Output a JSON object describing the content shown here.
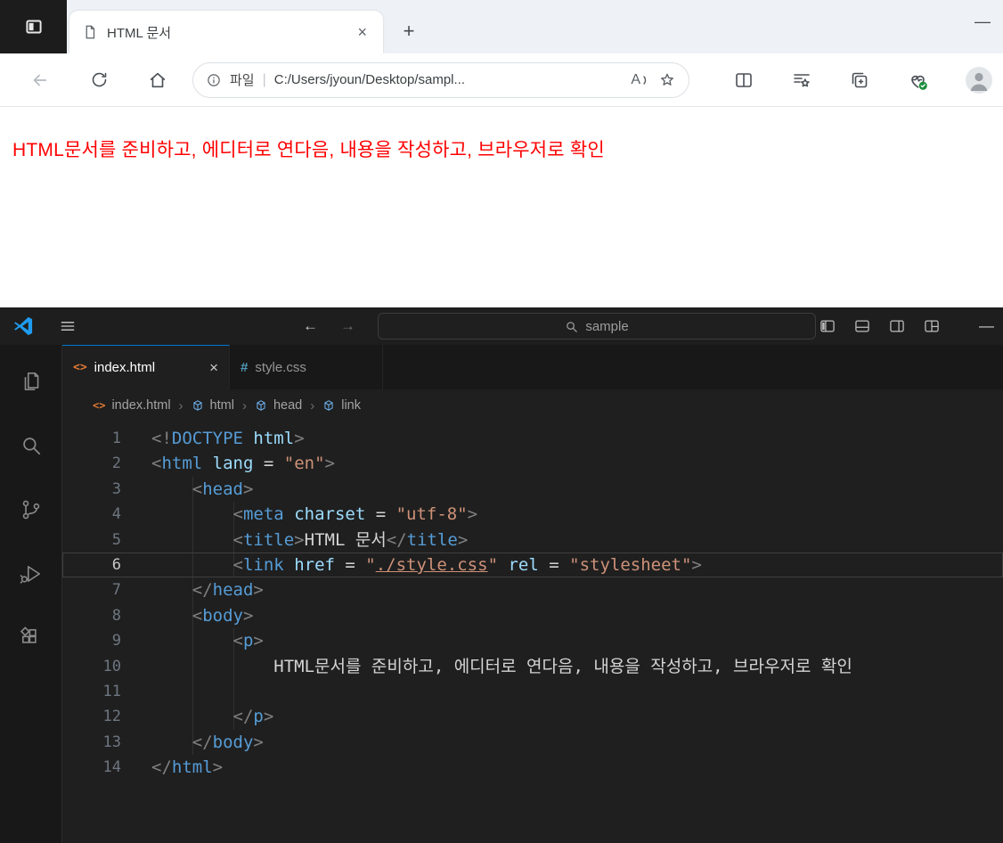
{
  "edge": {
    "tab": {
      "title": "HTML 문서",
      "close_glyph": "×"
    },
    "new_tab_glyph": "+",
    "minimize_glyph": "—",
    "toolbar": {
      "file_label": "파일",
      "divider": "|",
      "url": "C:/Users/jyoun/Desktop/sampl...",
      "read_aloud_glyph": "A"
    },
    "page": {
      "text": "HTML문서를 준비하고, 에디터로 연다음, 내용을 작성하고, 브라우저로 확인",
      "text_color": "#ff0000"
    }
  },
  "vscode": {
    "titlebar": {
      "back_glyph": "←",
      "forward_glyph": "→",
      "search_text": "sample",
      "minimize_glyph": "—"
    },
    "activity_bar": {
      "icons": [
        "files",
        "search",
        "source-control",
        "run-debug",
        "extensions"
      ]
    },
    "tabs": [
      {
        "icon": "<>",
        "label": "index.html",
        "close_glyph": "×",
        "active": true
      },
      {
        "icon": "#",
        "label": "style.css",
        "active": false
      }
    ],
    "breadcrumb": {
      "file_icon": "<>",
      "separator": "›",
      "items": [
        "index.html",
        "html",
        "head",
        "link"
      ]
    },
    "editor": {
      "current_line": 6,
      "lines": [
        {
          "n": 1,
          "tokens": [
            {
              "t": "<!",
              "c": "pu"
            },
            {
              "t": "DOCTYPE",
              "c": "tg"
            },
            {
              "t": " ",
              "c": "tx"
            },
            {
              "t": "html",
              "c": "at"
            },
            {
              "t": ">",
              "c": "pu"
            }
          ]
        },
        {
          "n": 2,
          "tokens": [
            {
              "t": "<",
              "c": "pu"
            },
            {
              "t": "html",
              "c": "tg"
            },
            {
              "t": " ",
              "c": "tx"
            },
            {
              "t": "lang",
              "c": "at"
            },
            {
              "t": " = ",
              "c": "op"
            },
            {
              "t": "\"en\"",
              "c": "st"
            },
            {
              "t": ">",
              "c": "pu"
            }
          ]
        },
        {
          "n": 3,
          "tokens": [
            {
              "t": "    ",
              "c": "tx"
            },
            {
              "t": "<",
              "c": "pu"
            },
            {
              "t": "head",
              "c": "tg"
            },
            {
              "t": ">",
              "c": "pu"
            }
          ]
        },
        {
          "n": 4,
          "tokens": [
            {
              "t": "        ",
              "c": "tx"
            },
            {
              "t": "<",
              "c": "pu"
            },
            {
              "t": "meta",
              "c": "tg"
            },
            {
              "t": " ",
              "c": "tx"
            },
            {
              "t": "charset",
              "c": "at"
            },
            {
              "t": " = ",
              "c": "op"
            },
            {
              "t": "\"utf-8\"",
              "c": "st"
            },
            {
              "t": ">",
              "c": "pu"
            }
          ]
        },
        {
          "n": 5,
          "tokens": [
            {
              "t": "        ",
              "c": "tx"
            },
            {
              "t": "<",
              "c": "pu"
            },
            {
              "t": "title",
              "c": "tg"
            },
            {
              "t": ">",
              "c": "pu"
            },
            {
              "t": "HTML 문서",
              "c": "tx"
            },
            {
              "t": "</",
              "c": "pu"
            },
            {
              "t": "title",
              "c": "tg"
            },
            {
              "t": ">",
              "c": "pu"
            }
          ]
        },
        {
          "n": 6,
          "tokens": [
            {
              "t": "        ",
              "c": "tx"
            },
            {
              "t": "<",
              "c": "pu"
            },
            {
              "t": "link",
              "c": "tg"
            },
            {
              "t": " ",
              "c": "tx"
            },
            {
              "t": "href",
              "c": "at"
            },
            {
              "t": " = ",
              "c": "op"
            },
            {
              "t": "\"",
              "c": "st"
            },
            {
              "t": "./style.css",
              "c": "lk"
            },
            {
              "t": "\"",
              "c": "st"
            },
            {
              "t": " ",
              "c": "tx"
            },
            {
              "t": "rel",
              "c": "at"
            },
            {
              "t": " = ",
              "c": "op"
            },
            {
              "t": "\"stylesheet\"",
              "c": "st"
            },
            {
              "t": ">",
              "c": "pu"
            }
          ]
        },
        {
          "n": 7,
          "tokens": [
            {
              "t": "    ",
              "c": "tx"
            },
            {
              "t": "</",
              "c": "pu"
            },
            {
              "t": "head",
              "c": "tg"
            },
            {
              "t": ">",
              "c": "pu"
            }
          ]
        },
        {
          "n": 8,
          "tokens": [
            {
              "t": "    ",
              "c": "tx"
            },
            {
              "t": "<",
              "c": "pu"
            },
            {
              "t": "body",
              "c": "tg"
            },
            {
              "t": ">",
              "c": "pu"
            }
          ]
        },
        {
          "n": 9,
          "tokens": [
            {
              "t": "        ",
              "c": "tx"
            },
            {
              "t": "<",
              "c": "pu"
            },
            {
              "t": "p",
              "c": "tg"
            },
            {
              "t": ">",
              "c": "pu"
            }
          ]
        },
        {
          "n": 10,
          "tokens": [
            {
              "t": "            HTML문서를 준비하고, 에디터로 연다음, 내용을 작성하고, 브라우저로 확인",
              "c": "tx"
            }
          ]
        },
        {
          "n": 11,
          "tokens": []
        },
        {
          "n": 12,
          "tokens": [
            {
              "t": "        ",
              "c": "tx"
            },
            {
              "t": "</",
              "c": "pu"
            },
            {
              "t": "p",
              "c": "tg"
            },
            {
              "t": ">",
              "c": "pu"
            }
          ]
        },
        {
          "n": 13,
          "tokens": [
            {
              "t": "    ",
              "c": "tx"
            },
            {
              "t": "</",
              "c": "pu"
            },
            {
              "t": "body",
              "c": "tg"
            },
            {
              "t": ">",
              "c": "pu"
            }
          ]
        },
        {
          "n": 14,
          "tokens": [
            {
              "t": "</",
              "c": "pu"
            },
            {
              "t": "html",
              "c": "tg"
            },
            {
              "t": ">",
              "c": "pu"
            }
          ]
        }
      ]
    }
  },
  "colors": {
    "accent_blue": "#0078d4",
    "tag": "#569cd6",
    "attribute": "#9cdcfe",
    "string": "#ce9178",
    "punctuation": "#808080",
    "code_text": "#d4d4d4",
    "html_icon": "#e37933",
    "css_icon": "#519aba",
    "red_text": "#ff0000"
  }
}
